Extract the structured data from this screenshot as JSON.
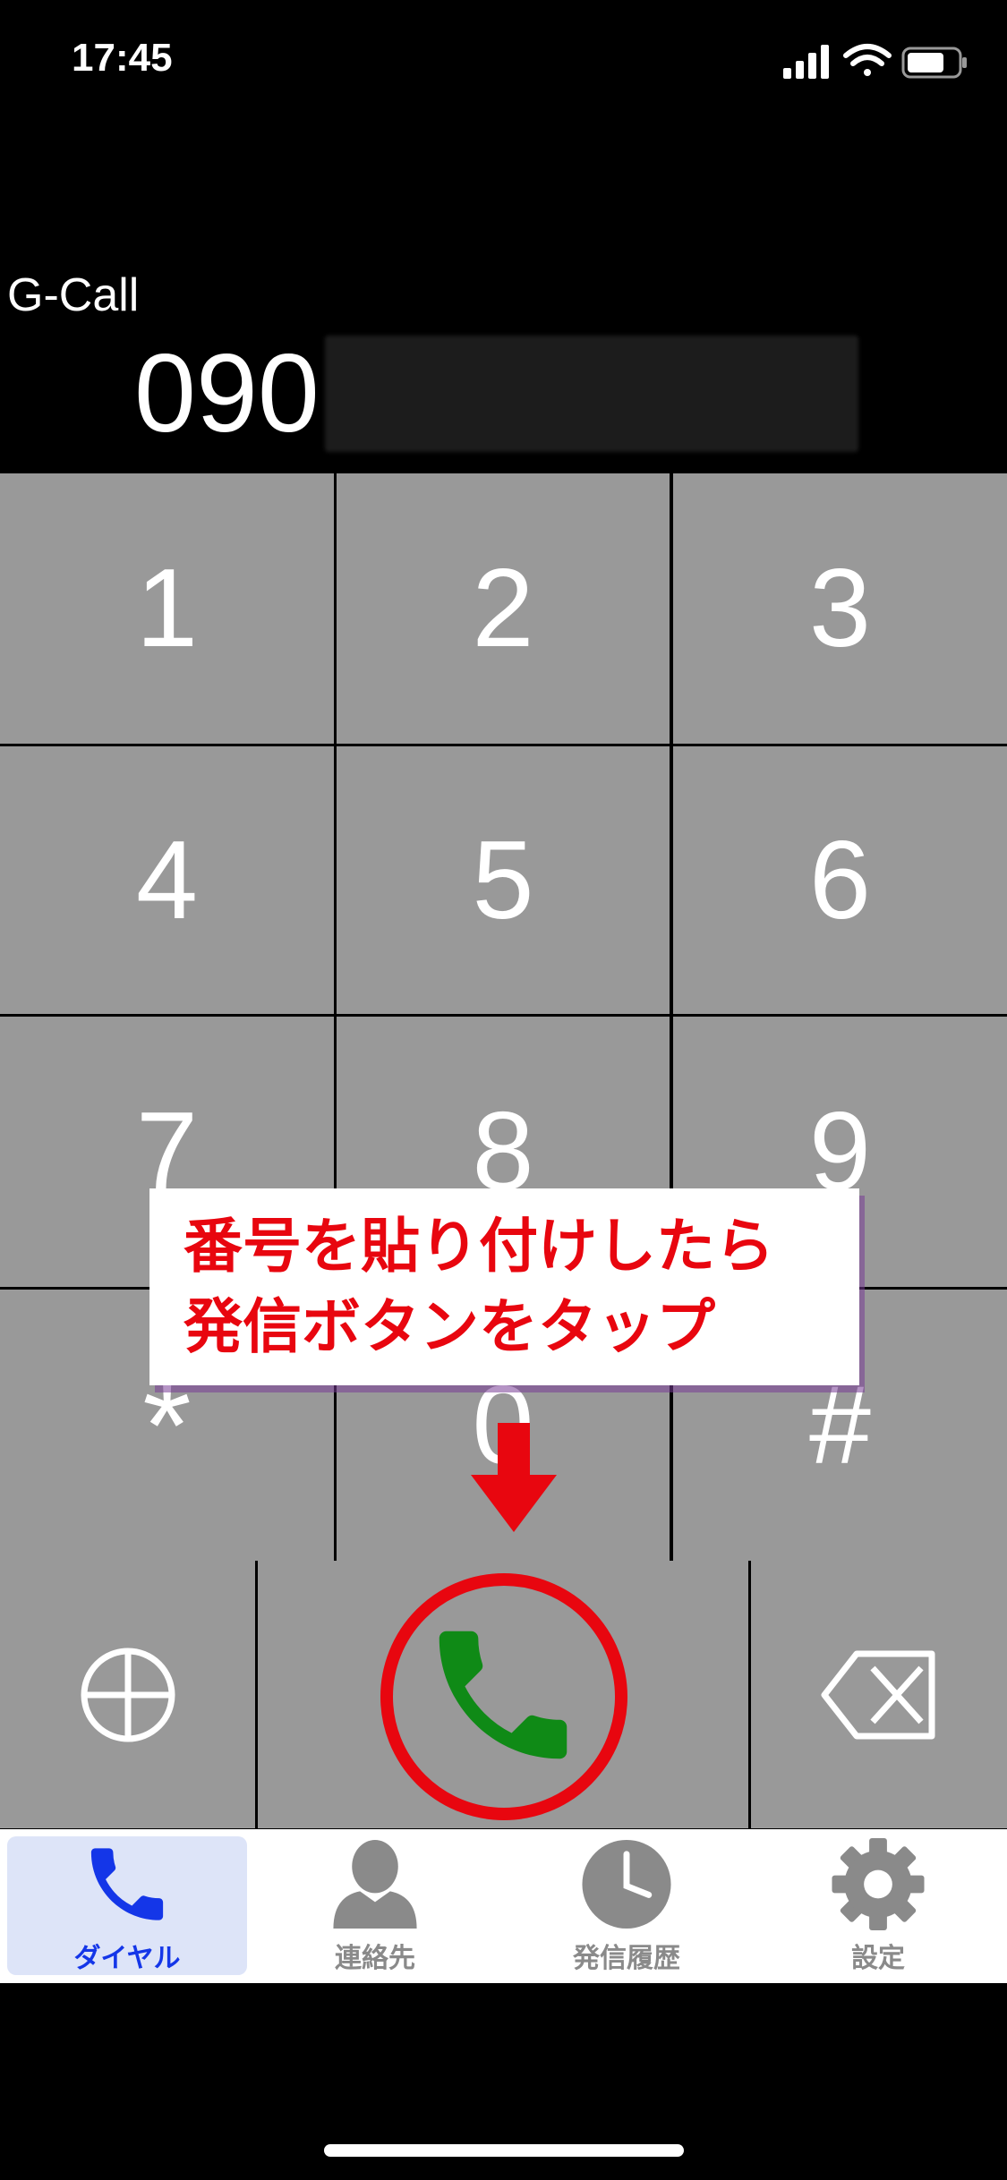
{
  "status_bar": {
    "time": "17:45"
  },
  "header": {
    "app_name": "G-Call",
    "number_prefix": "090"
  },
  "keypad": {
    "keys": [
      {
        "label": "1",
        "name": "key-1"
      },
      {
        "label": "2",
        "name": "key-2"
      },
      {
        "label": "3",
        "name": "key-3"
      },
      {
        "label": "4",
        "name": "key-4"
      },
      {
        "label": "5",
        "name": "key-5"
      },
      {
        "label": "6",
        "name": "key-6"
      },
      {
        "label": "7",
        "name": "key-7"
      },
      {
        "label": "8",
        "name": "key-8"
      },
      {
        "label": "9",
        "name": "key-9"
      },
      {
        "label": "*",
        "name": "key-star"
      },
      {
        "label": "0",
        "name": "key-0"
      },
      {
        "label": "#",
        "name": "key-hash"
      }
    ]
  },
  "annotation": {
    "line1": "番号を貼り付けしたら",
    "line2": "発信ボタンをタップ",
    "color": "#e8060f"
  },
  "bottom_row": {
    "add_icon": "circle-plus-icon",
    "call_icon": "phone-icon",
    "call_color": "#0f8a16",
    "delete_icon": "backspace-icon"
  },
  "tab_bar": {
    "active_color": "#1436e8",
    "tabs": [
      {
        "label": "ダイヤル",
        "icon": "phone-icon",
        "active": true
      },
      {
        "label": "連絡先",
        "icon": "person-icon",
        "active": false
      },
      {
        "label": "発信履歴",
        "icon": "clock-icon",
        "active": false
      },
      {
        "label": "設定",
        "icon": "gear-icon",
        "active": false
      }
    ]
  }
}
